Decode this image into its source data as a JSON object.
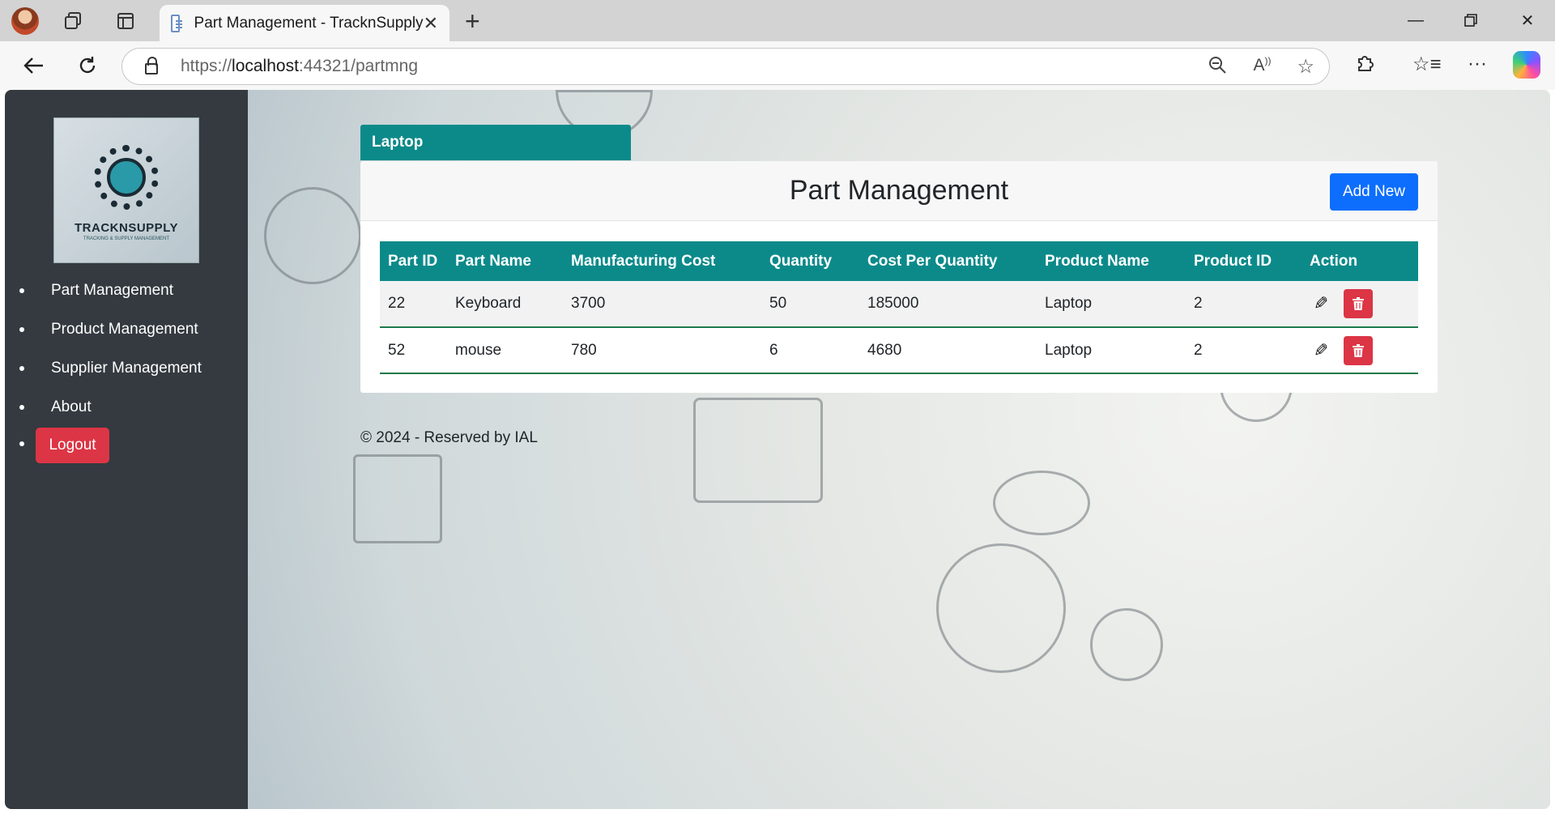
{
  "browser": {
    "tab_title": "Part Management - TracknSupply",
    "url_prefix": "https://",
    "url_host": "localhost",
    "url_rest": ":44321/partmng"
  },
  "sidebar": {
    "logo_text": "TRACKNSUPPLY",
    "logo_subtext": "TRACKING & SUPPLY MANAGEMENT",
    "items": [
      {
        "label": "Part Management"
      },
      {
        "label": "Product Management"
      },
      {
        "label": "Supplier Management"
      },
      {
        "label": "About"
      }
    ],
    "logout_label": "Logout"
  },
  "main": {
    "product_tab": "Laptop",
    "title": "Part Management",
    "add_button": "Add New",
    "table": {
      "headers": [
        "Part ID",
        "Part Name",
        "Manufacturing Cost",
        "Quantity",
        "Cost Per Quantity",
        "Product Name",
        "Product ID",
        "Action"
      ],
      "rows": [
        {
          "part_id": "22",
          "part_name": "Keyboard",
          "manufacturing_cost": "3700",
          "quantity": "50",
          "cost_per_quantity": "185000",
          "product_name": "Laptop",
          "product_id": "2"
        },
        {
          "part_id": "52",
          "part_name": "mouse",
          "manufacturing_cost": "780",
          "quantity": "6",
          "cost_per_quantity": "4680",
          "product_name": "Laptop",
          "product_id": "2"
        }
      ]
    },
    "footer": "© 2024 - Reserved by IAL"
  },
  "colors": {
    "teal": "#0c8a8a",
    "primary": "#0d6efd",
    "danger": "#dc3545",
    "sidebar": "#343a40"
  }
}
